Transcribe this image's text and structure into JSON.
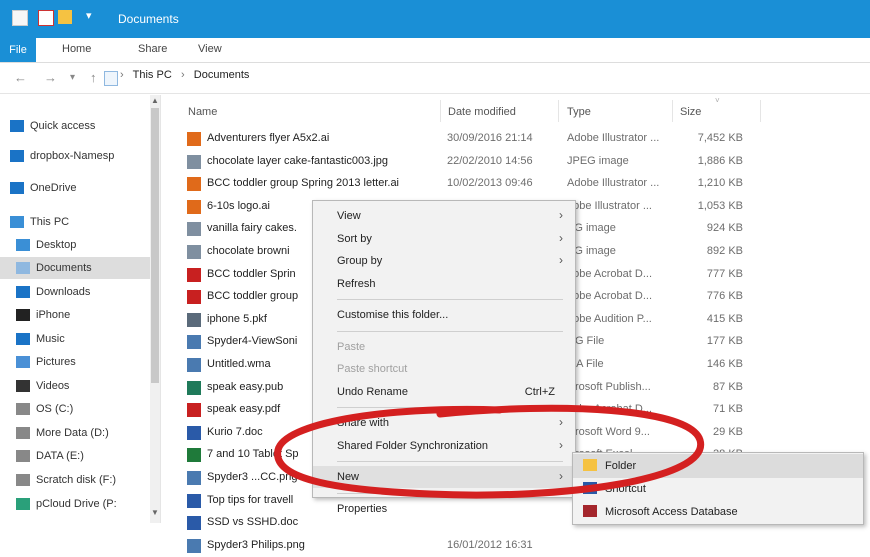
{
  "window": {
    "title": "Documents"
  },
  "ribbon": {
    "tabs": [
      "File",
      "Home",
      "Share",
      "View"
    ]
  },
  "nav": {
    "path": [
      "This PC",
      "Documents"
    ]
  },
  "sidebar": {
    "items": [
      {
        "label": "Quick access",
        "icon": "star-icon",
        "color": "#1a73c6"
      },
      {
        "label": "dropbox-Namesp",
        "icon": "dropbox-icon",
        "color": "#1a73c6"
      },
      {
        "label": "OneDrive",
        "icon": "cloud-icon",
        "color": "#1a73c6"
      },
      {
        "label": "This PC",
        "icon": "computer-icon",
        "color": "#3a8fd6"
      },
      {
        "label": "Desktop",
        "icon": "desktop-icon",
        "color": "#3a8fd6"
      },
      {
        "label": "Documents",
        "icon": "documents-icon",
        "color": "#8fb8e0"
      },
      {
        "label": "Downloads",
        "icon": "download-icon",
        "color": "#1a73c6"
      },
      {
        "label": "iPhone",
        "icon": "phone-icon",
        "color": "#222222"
      },
      {
        "label": "Music",
        "icon": "music-icon",
        "color": "#1a73c6"
      },
      {
        "label": "Pictures",
        "icon": "pictures-icon",
        "color": "#4a90d6"
      },
      {
        "label": "Videos",
        "icon": "video-icon",
        "color": "#333333"
      },
      {
        "label": "OS (C:)",
        "icon": "drive-icon",
        "color": "#888888"
      },
      {
        "label": "More Data (D:)",
        "icon": "drive-icon",
        "color": "#888888"
      },
      {
        "label": "DATA (E:)",
        "icon": "drive-icon",
        "color": "#888888"
      },
      {
        "label": "Scratch disk (F:)",
        "icon": "drive-icon",
        "color": "#888888"
      },
      {
        "label": "pCloud Drive (P:",
        "icon": "cloud-drive-icon",
        "color": "#2aa07a"
      }
    ]
  },
  "columns": {
    "name": "Name",
    "date": "Date modified",
    "type": "Type",
    "size": "Size"
  },
  "files": [
    {
      "name": "Adventurers flyer A5x2.ai",
      "date": "30/09/2016 21:14",
      "type": "Adobe Illustrator ...",
      "size": "7,452 KB",
      "icon": "ai-file-icon",
      "color": "#e06a1a"
    },
    {
      "name": "chocolate layer cake-fantastic003.jpg",
      "date": "22/02/2010 14:56",
      "type": "JPEG image",
      "size": "1,886 KB",
      "icon": "image-file-icon",
      "color": "#7f8fa0"
    },
    {
      "name": "BCC toddler group Spring 2013 letter.ai",
      "date": "10/02/2013 09:46",
      "type": "Adobe Illustrator ...",
      "size": "1,210 KB",
      "icon": "ai-file-icon",
      "color": "#e06a1a"
    },
    {
      "name": "6-10s logo.ai",
      "date": "",
      "type": "dobe Illustrator ...",
      "size": "1,053 KB",
      "icon": "ai-file-icon",
      "color": "#e06a1a"
    },
    {
      "name": "vanilla fairy cakes.",
      "date": "",
      "type": "EG image",
      "size": "924 KB",
      "icon": "image-file-icon",
      "color": "#7f8fa0"
    },
    {
      "name": "chocolate browni",
      "date": "",
      "type": "EG image",
      "size": "892 KB",
      "icon": "image-file-icon",
      "color": "#7f8fa0"
    },
    {
      "name": "BCC toddler Sprin",
      "date": "",
      "type": "dobe Acrobat D...",
      "size": "777 KB",
      "icon": "pdf-file-icon",
      "color": "#c82020"
    },
    {
      "name": "BCC toddler group",
      "date": "",
      "type": "dobe Acrobat D...",
      "size": "776 KB",
      "icon": "pdf-file-icon",
      "color": "#c82020"
    },
    {
      "name": "iphone 5.pkf",
      "date": "",
      "type": "dobe Audition P...",
      "size": "415 KB",
      "icon": "pkf-file-icon",
      "color": "#5a6a7a"
    },
    {
      "name": "Spyder4-ViewSoni",
      "date": "",
      "type": "NG File",
      "size": "177 KB",
      "icon": "png-file-icon",
      "color": "#4a7ab0"
    },
    {
      "name": "Untitled.wma",
      "date": "",
      "type": "MA File",
      "size": "146 KB",
      "icon": "audio-file-icon",
      "color": "#4a7ab0"
    },
    {
      "name": "speak easy.pub",
      "date": "",
      "type": "icrosoft Publish...",
      "size": "87 KB",
      "icon": "pub-file-icon",
      "color": "#1f7a5a"
    },
    {
      "name": "speak easy.pdf",
      "date": "",
      "type": "dobe Acrobat D...",
      "size": "71 KB",
      "icon": "pdf-file-icon",
      "color": "#c82020"
    },
    {
      "name": "Kurio 7.doc",
      "date": "",
      "type": "icrosoft Word 9...",
      "size": "29 KB",
      "icon": "doc-file-icon",
      "color": "#2a5aa8"
    },
    {
      "name": "7 and 10 Tablet Sp",
      "date": "",
      "type": "icrosoft Excel",
      "size": "28 KB",
      "icon": "xls-file-icon",
      "color": "#1f7a3a"
    },
    {
      "name": "Spyder3 ...CC.png",
      "date": "",
      "type": "",
      "size": "",
      "icon": "png-file-icon",
      "color": "#4a7ab0"
    },
    {
      "name": "Top tips for travell",
      "date": "",
      "type": "",
      "size": "",
      "icon": "doc-file-icon",
      "color": "#2a5aa8"
    },
    {
      "name": "SSD vs SSHD.doc",
      "date": "",
      "type": "",
      "size": "",
      "icon": "doc-file-icon",
      "color": "#2a5aa8"
    },
    {
      "name": "Spyder3 Philips.png",
      "date": "16/01/2012 16:31",
      "type": "",
      "size": "",
      "icon": "png-file-icon",
      "color": "#4a7ab0"
    }
  ],
  "context_menu": {
    "items": [
      {
        "label": "View",
        "submenu": true
      },
      {
        "label": "Sort by",
        "submenu": true
      },
      {
        "label": "Group by",
        "submenu": true
      },
      {
        "label": "Refresh"
      },
      {
        "separator": true
      },
      {
        "label": "Customise this folder..."
      },
      {
        "separator": true
      },
      {
        "label": "Paste",
        "disabled": true
      },
      {
        "label": "Paste shortcut",
        "disabled": true
      },
      {
        "label": "Undo Rename",
        "shortcut": "Ctrl+Z"
      },
      {
        "separator": true
      },
      {
        "label": "Share with",
        "submenu": true
      },
      {
        "label": "Shared Folder Synchronization",
        "submenu": true
      },
      {
        "separator": true
      },
      {
        "label": "New",
        "submenu": true,
        "highlighted": true
      },
      {
        "separator": true
      },
      {
        "label": "Properties"
      }
    ]
  },
  "new_submenu": {
    "items": [
      {
        "label": "Folder",
        "icon": "folder-icon",
        "highlighted": true
      },
      {
        "label": "Shortcut",
        "icon": "shortcut-icon"
      },
      {
        "label": "Microsoft Access Database",
        "icon": "access-icon"
      }
    ]
  },
  "annotation_color": "#d42020"
}
